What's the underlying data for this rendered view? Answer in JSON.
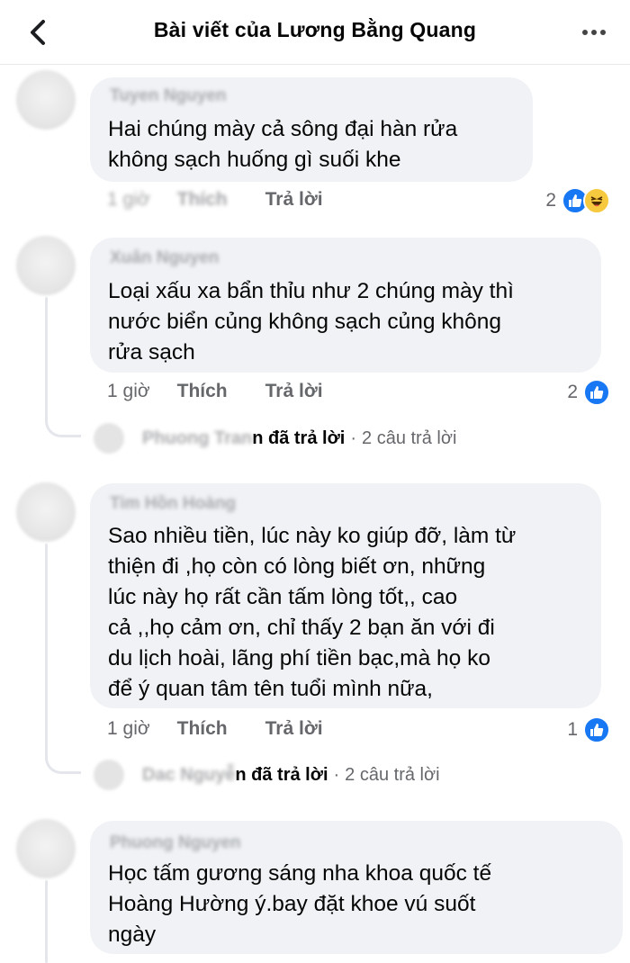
{
  "header": {
    "title": "Bài viết của Lương Bằng Quang"
  },
  "comments": [
    {
      "author": "Tuyen Nguyen",
      "text": "Hai chúng mày cả sông đại hàn rửa\nkhông sạch huống gì suối khe",
      "time": "1 giờ",
      "like": "Thích",
      "reply": "Trả lời",
      "reaction_count": "2",
      "reactions": [
        "like-icon",
        "haha-icon"
      ]
    },
    {
      "author": "Xuân Nguyen",
      "text": "Loại xấu xa bẩn thỉu như 2 chúng mày thì\nnước biển củng không sạch củng không\nrửa sạch",
      "time": "1 giờ",
      "like": "Thích",
      "reply": "Trả lời",
      "reaction_count": "2",
      "reactions": [
        "like-icon"
      ],
      "replies": {
        "name": "Phuong Tran",
        "suffix": "n đã trả lời",
        "sep": "·",
        "count": "2 câu trả lời"
      }
    },
    {
      "author": "Tim Hồn Hoàng",
      "text": "Sao nhiều tiền, lúc này ko giúp đỡ, làm từ\nthiện đi ,họ còn có lòng biết ơn,  những\nlúc này họ rất cần tấm lòng tốt,, cao\ncả ,,họ cảm ơn, chỉ thấy 2 bạn ăn với đi\ndu lịch hoài, lãng phí tiền bạc,mà họ ko\nđể ý quan tâm tên tuổi mình nữa,",
      "time": "1 giờ",
      "like": "Thích",
      "reply": "Trả lời",
      "reaction_count": "1",
      "reactions": [
        "like-icon"
      ],
      "replies": {
        "name": "Dac Nguyễ",
        "suffix": "n đã trả lời",
        "sep": "·",
        "count": "2 câu trả lời"
      }
    },
    {
      "author": "Phuong Nguyen",
      "text": "Học tấm gương sáng nha khoa quốc tế\nHoàng Hường ý.bay đặt khoe vú suốt\nngày"
    }
  ],
  "colors": {
    "bubble": "#f0f2f5",
    "like_blue": "#1877f2",
    "meta_gray": "#65676b"
  }
}
